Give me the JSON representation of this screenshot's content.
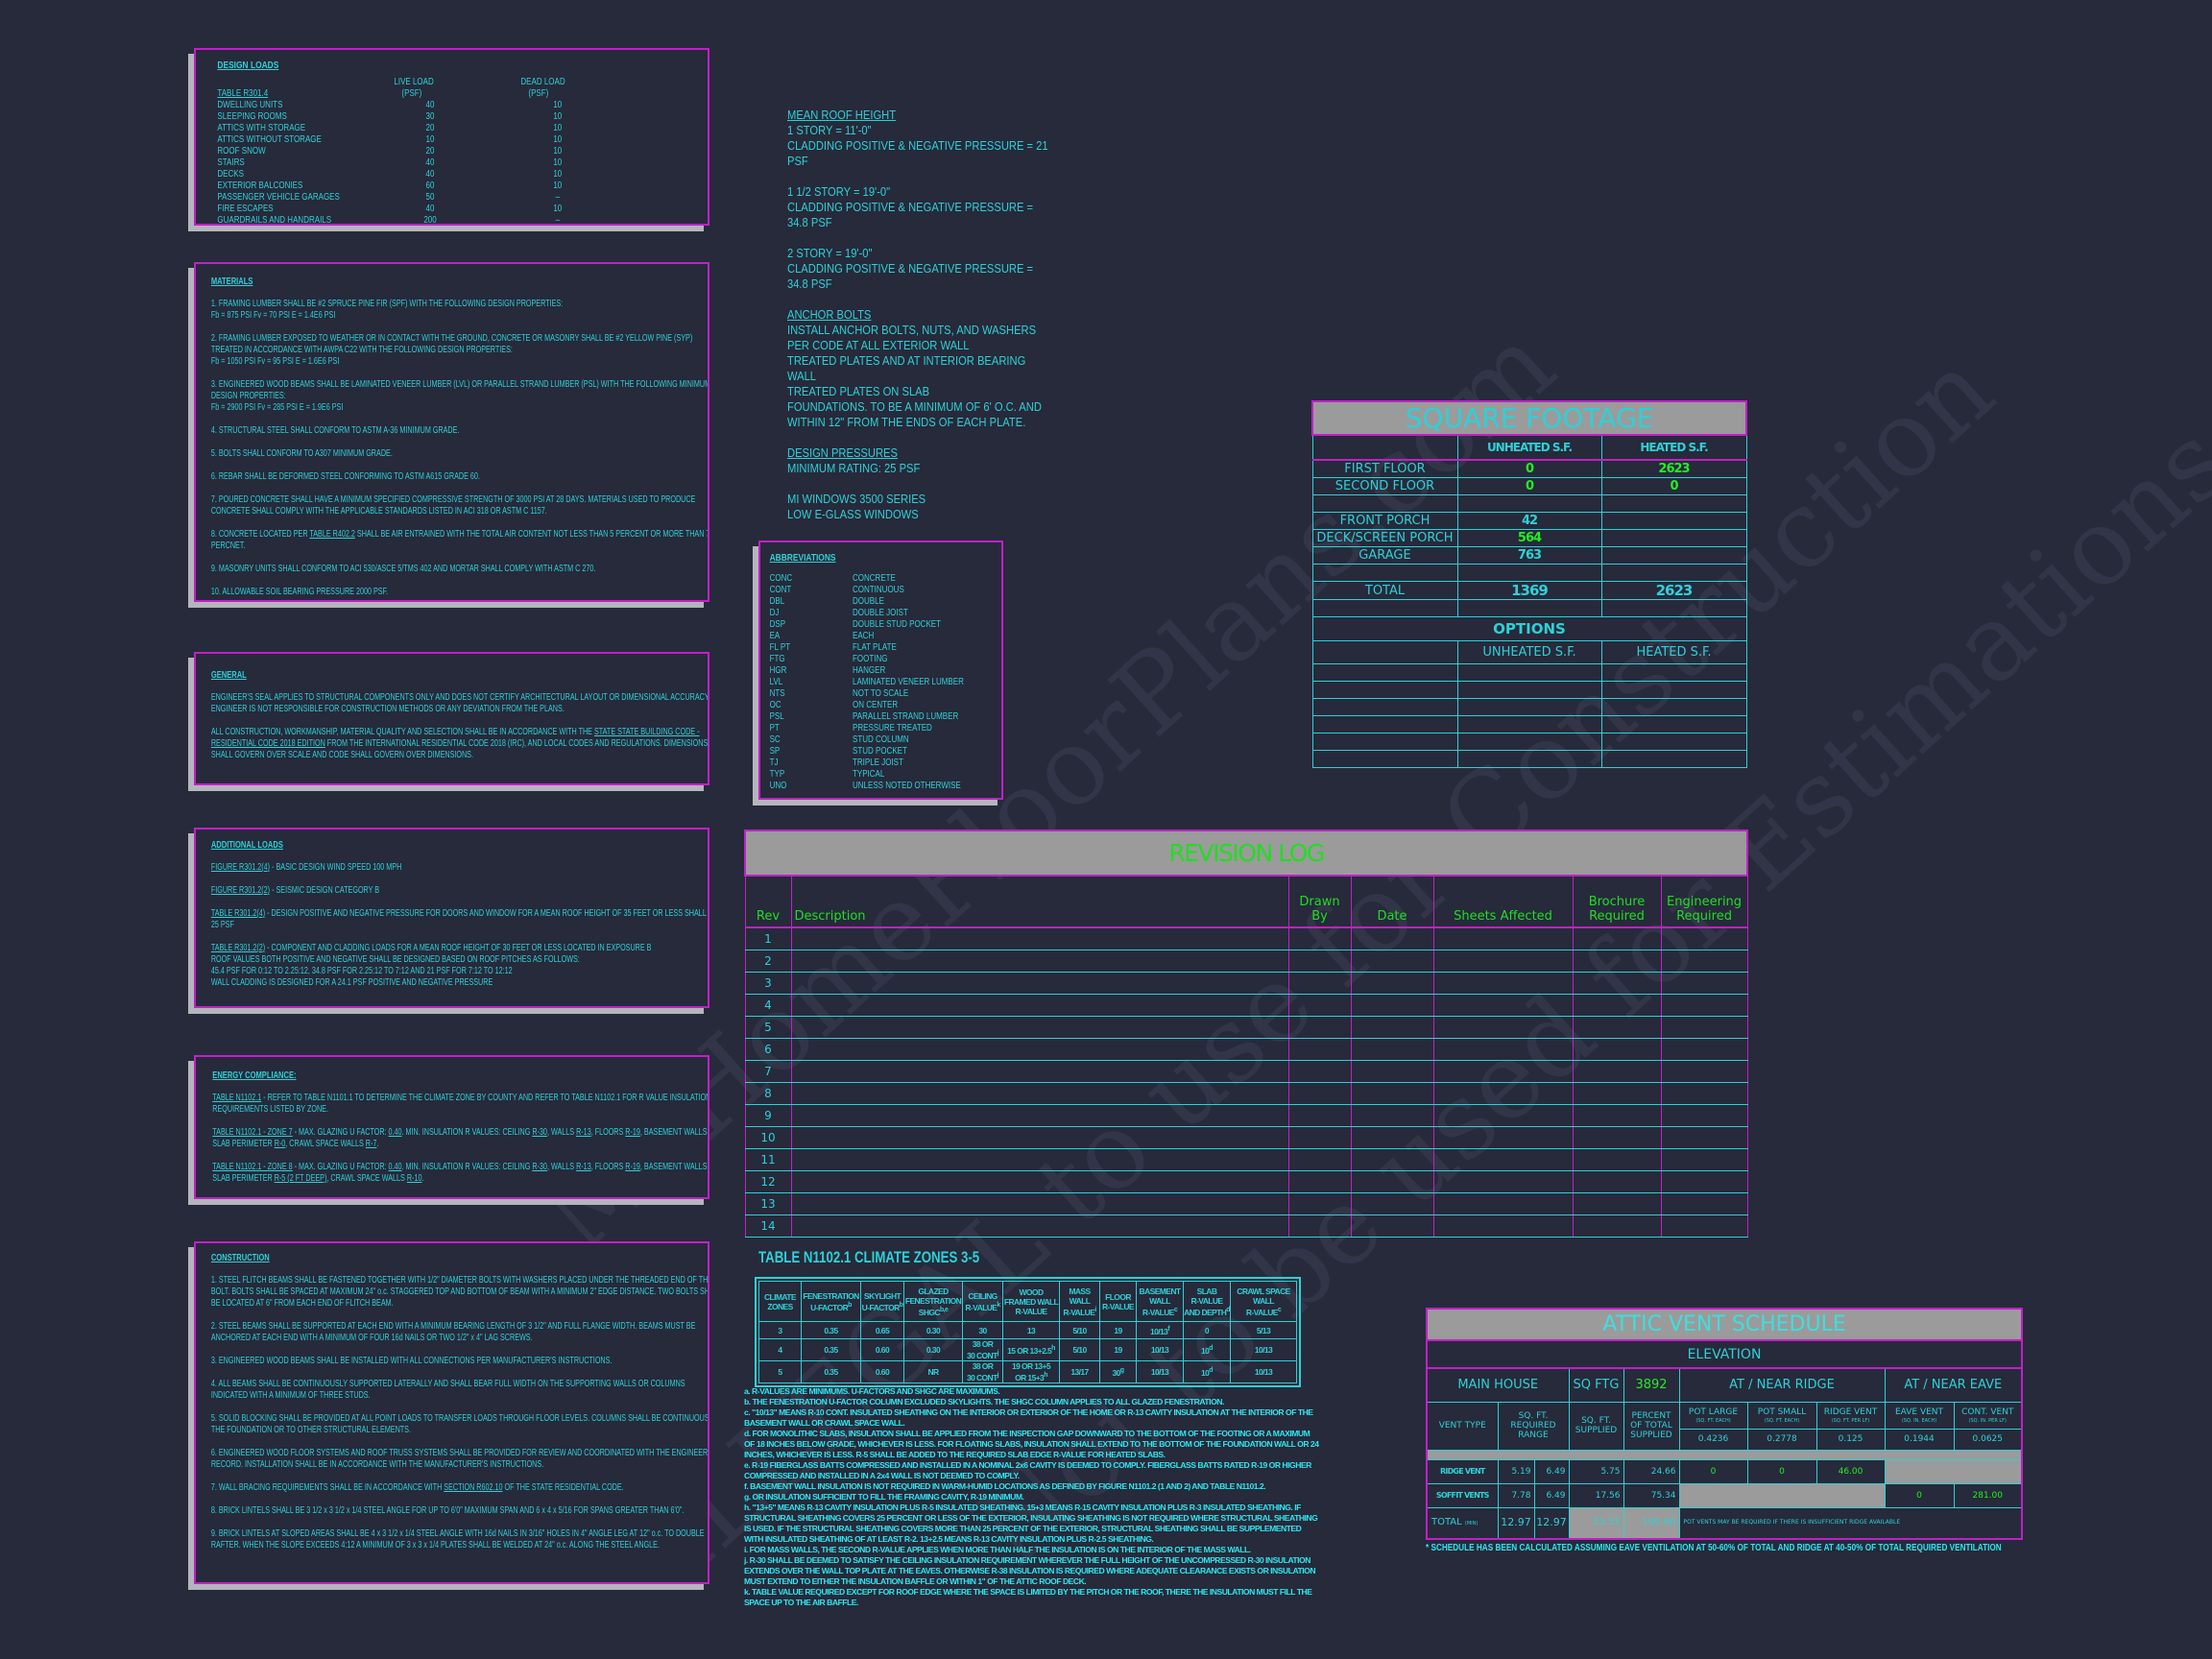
{
  "colors": {
    "background": "#262a3b",
    "text": "#2fd0d6",
    "border": "#c21fc8",
    "highlight": "#22ee22",
    "band": "#9b9b9b"
  },
  "watermark": [
    "© MyHomeFloorPlans.com",
    "ILLEGAL to use for Construction",
    "Not to be used for Estimations"
  ],
  "design_loads": {
    "title": "DESIGN LOADS",
    "table_ref": "TABLE R301.4",
    "live_header": "LIVE LOAD",
    "dead_header": "DEAD LOAD",
    "unit": "(PSF)",
    "rows": [
      [
        "DWELLING UNITS",
        "40",
        "10"
      ],
      [
        "SLEEPING ROOMS",
        "30",
        "10"
      ],
      [
        "ATTICS WITH STORAGE",
        "20",
        "10"
      ],
      [
        "ATTICS WITHOUT STORAGE",
        "10",
        "10"
      ],
      [
        "ROOF SNOW",
        "20",
        "10"
      ],
      [
        "STAIRS",
        "40",
        "10"
      ],
      [
        "DECKS",
        "40",
        "10"
      ],
      [
        "EXTERIOR BALCONIES",
        "60",
        "10"
      ],
      [
        "PASSENGER VEHICLE GARAGES",
        "50",
        "–"
      ],
      [
        "FIRE ESCAPES",
        "40",
        "10"
      ],
      [
        "GUARDRAILS AND HANDRAILS",
        "200",
        "–"
      ]
    ]
  },
  "materials": {
    "title": "MATERIALS",
    "items": [
      [
        "1. FRAMING LUMBER SHALL BE #2 SPRUCE PINE FIR (SPF) WITH THE FOLLOWING DESIGN PROPERTIES:\nFb = 875 PSI     Fv = 70 PSI     E = 1.4E6 PSI"
      ],
      [
        "2. FRAMING LUMBER EXPOSED TO WEATHER OR IN CONTACT WITH THE GROUND, CONCRETE OR MASONRY SHALL BE #2 YELLOW PINE (SYP) TREATED IN ACCORDANCE WITH AWPA C22 WITH THE FOLLOWING DESIGN PROPERTIES:\nFb = 1050 PSI    Fv = 95 PSI    E = 1.6E6 PSI"
      ],
      [
        "3. ENGINEERED WOOD BEAMS SHALL BE LAMINATED VENEER LUMBER (LVL) OR PARALLEL STRAND LUMBER (PSL) WITH THE FOLLOWING MINIMUM DESIGN PROPERTIES:\nFb = 2900 PSI    Fv = 285 PSI    E = 1.9E6 PSI"
      ],
      [
        "4. STRUCTURAL STEEL SHALL CONFORM TO ASTM A-36 MINIMUM GRADE."
      ],
      [
        "5. BOLTS SHALL CONFORM TO A307 MINIMUM GRADE."
      ],
      [
        "6. REBAR SHALL BE DEFORMED STEEL CONFORMING TO ASTM A615 GRADE 60."
      ],
      [
        "7. POURED CONCRETE SHALL HAVE A MINIMUM SPECIFIED COMPRESSIVE STRENGTH OF 3000 PSI AT 28 DAYS.  MATERIALS USED TO PRODUCE CONCRETE SHALL COMPLY WITH THE APPLICABLE STANDARDS LISTED IN ACI 318 OR ASTM C 1157."
      ],
      [
        "8. CONCRETE LOCATED PER ",
        {
          "u": "TABLE R402.2"
        },
        " SHALL BE AIR ENTRAINED WITH THE TOTAL AIR CONTENT NOT LESS THAN 5 PERCENT OR MORE THAN 7 PERCNET."
      ],
      [
        "9. MASONRY UNITS SHALL CONFORM TO ACI 530/ASCE 5/TMS 402 AND MORTAR SHALL COMPLY WITH ASTM C 270."
      ],
      [
        "10. ALLOWABLE SOIL BEARING PRESSURE 2000 PSF."
      ]
    ]
  },
  "general": {
    "title": "GENERAL",
    "items": [
      [
        "ENGINEER'S SEAL APPLIES TO STRUCTURAL COMPONENTS ONLY AND DOES NOT CERTIFY ARCHITECTURAL LAYOUT OR DIMENSIONAL ACCURACY.  ENGINEER IS NOT RESPONSIBLE FOR CONSTRUCTION METHODS OR ANY DEVIATION FROM THE PLANS."
      ],
      [
        "ALL CONSTRUCTION, WORKMANSHIP, MATERIAL QUALITY AND SELECTION SHALL BE IN ACCORDANCE WITH THE ",
        {
          "u": "STATE STATE BUILDING CODE - RESIDENTIAL CODE 2018 EDITION"
        },
        " FROM THE INTERNATIONAL RESIDENTIAL CODE 2018 (IRC), AND LOCAL CODES AND REGULATIONS.  DIMENSIONS SHALL GOVERN OVER SCALE AND CODE SHALL GOVERN OVER DIMENSIONS."
      ]
    ]
  },
  "additional_loads": {
    "title": "ADDITIONAL LOADS",
    "items": [
      [
        {
          "u": "FIGURE R301.2(4)"
        },
        " - BASIC DESIGN WIND SPEED 100 MPH"
      ],
      [
        {
          "u": "FIGURE R301.2(2)"
        },
        " - SEISMIC DESIGN CATEGORY B"
      ],
      [
        {
          "u": "TABLE R301.2(4)"
        },
        " - DESIGN POSITIVE AND NEGATIVE PRESSURE FOR DOORS AND WINDOW FOR A MEAN ROOF HEIGHT OF 35 FEET OR LESS SHALL BE 25 PSF"
      ],
      [
        {
          "u": "TABLE R301.2(2)"
        },
        " - COMPONENT AND CLADDING LOADS FOR A MEAN ROOF HEIGHT OF 30 FEET OR LESS LOCATED IN EXPOSURE B\nROOF VALUES BOTH POSITIVE AND NEGATIVE SHALL BE DESIGNED BASED ON ROOF PITCHES AS FOLLOWS:\n45.4 PSF FOR 0:12 TO 2.25:12, 34.8 PSF FOR 2.25:12 TO 7:12 AND 21 PSF FOR 7:12 TO 12:12\nWALL CLADDING IS DESIGNED FOR A 24.1 PSF POSITIVE AND NEGATIVE PRESSURE"
      ]
    ]
  },
  "energy": {
    "title": "ENERGY COMPLIANCE:",
    "items": [
      [
        {
          "u": "TABLE N1102.1"
        },
        " - REFER TO TABLE N1101.1 TO DETERMINE THE CLIMATE ZONE BY COUNTY  AND REFER TO TABLE N1102.1 FOR R VALUE INSULATION REQUIREMENTS LISTED BY ZONE."
      ],
      [
        {
          "u": "TABLE N1102.1 - ZONE 7"
        },
        " - MAX. GLAZING U FACTOR: ",
        {
          "u": "0.40"
        },
        ".  MIN. INSULATION R VALUES: CEILING ",
        {
          "u": "R-30"
        },
        ", WALLS ",
        {
          "u": "R-13"
        },
        ", FLOORS ",
        {
          "u": "R-19"
        },
        ", BASEMENT WALLS ",
        {
          "u": "R-7"
        },
        ", SLAB PERIMETER ",
        {
          "u": "R-0"
        },
        ", CRAWL SPACE WALLS ",
        {
          "u": "R-7"
        },
        "."
      ],
      [
        {
          "u": "TABLE N1102.1 - ZONE 8"
        },
        " - MAX. GLAZING U FACTOR: ",
        {
          "u": "0.40"
        },
        ".  MIN. INSULATION R VALUES: CEILING ",
        {
          "u": "R-30"
        },
        ", WALLS ",
        {
          "u": "R-13"
        },
        ", FLOORS ",
        {
          "u": "R-19"
        },
        ", BASEMENT WALLS ",
        {
          "u": "R-8"
        },
        ", SLAB PERIMETER ",
        {
          "u": "R-5 (2 FT DEEP)"
        },
        ", CRAWL SPACE WALLS ",
        {
          "u": "R-10"
        },
        "."
      ]
    ]
  },
  "construction": {
    "title": "CONSTRUCTION",
    "items": [
      [
        "1. STEEL FLITCH BEAMS SHALL BE FASTENED TOGETHER WITH 1/2\" DIAMETER BOLTS WITH WASHERS PLACED UNDER THE THREADED END OF THE BOLT.  BOLTS SHALL BE SPACED AT MAXIMUM 24\" o.c. STAGGERED TOP AND BOTTOM OF BEAM WITH A MINIMUM 2\" EDGE DISTANCE.  TWO BOLTS SHALL BE LOCATED AT 6\" FROM EACH END OF FLITCH BEAM."
      ],
      [
        "2. STEEL BEAMS SHALL BE SUPPORTED AT EACH END WITH A MINIMUM BEARING LENGTH OF 3 1/2\" AND FULL FLANGE WIDTH. BEAMS MUST BE ANCHORED AT EACH END WITH A MINIMUM OF FOUR 16d NAILS OR TWO 1/2\" x 4\" LAG SCREWS."
      ],
      [
        "3. ENGINEERED WOOD BEAMS SHALL BE INSTALLED WITH ALL CONNECTIONS PER MANUFACTURER'S INSTRUCTIONS."
      ],
      [
        "4. ALL BEAMS SHALL BE CONTINUOUSLY SUPPORTED LATERALLY AND SHALL BEAR FULL WIDTH ON THE SUPPORTING WALLS OR COLUMNS INDICATED WITH A MINIMUM OF THREE STUDS."
      ],
      [
        "5. SOLID BLOCKING SHALL BE PROVIDED AT ALL POINT LOADS TO TRANSFER LOADS THROUGH FLOOR LEVELS.  COLUMNS SHALL BE CONTINUOUS TO THE FOUNDATION OR TO OTHER STRUCTURAL ELEMENTS."
      ],
      [
        "6. ENGINEERED WOOD FLOOR SYSTEMS AND ROOF TRUSS SYSTEMS SHALL BE PROVIDED FOR REVIEW AND COORDINATED WITH THE ENGINEER OF RECORD.  INSTALLATION SHALL BE IN ACCORDANCE WITH THE MANUFACTURER'S INSTRUCTIONS."
      ],
      [
        "7. WALL BRACING REQUIREMENTS SHALL BE IN ACCORDANCE WITH ",
        {
          "u": "SECTION R602.10"
        },
        " OF THE STATE RESIDENTIAL CODE."
      ],
      [
        "8. BRICK LINTELS SHALL BE 3 1/2 x 3 1/2 x 1/4 STEEL ANGLE FOR UP TO 6'0\" MAXIMUM SPAN AND 6 x 4 x 5/16 FOR SPANS GREATER THAN 6'0\"."
      ],
      [
        "9. BRICK LINTELS AT SLOPED AREAS SHALL BE 4 x 3 1/2 x 1/4 STEEL ANGLE WITH 16d NAILS IN 3/16\" HOLES IN 4\" ANGLE LEG AT 12\" o.c. TO DOUBLE RAFTER.  WHEN THE SLOPE EXCEEDS 4:12 A MINIMUM OF 3 x 3 x 1/4 PLATES SHALL BE WELDED AT 24\" o.c. ALONG THE STEEL ANGLE."
      ]
    ]
  },
  "roof_notes": [
    {
      "heading": "MEAN ROOF HEIGHT",
      "text": "1 STORY = 11'-0\"\nCLADDING POSITIVE & NEGATIVE PRESSURE = 21\nPSF"
    },
    {
      "heading": "",
      "text": "1 1/2 STORY = 19'-0\"\nCLADDING POSITIVE & NEGATIVE PRESSURE =\n34.8 PSF"
    },
    {
      "heading": "",
      "text": "2 STORY = 19'-0\"\nCLADDING POSITIVE & NEGATIVE PRESSURE =\n34.8 PSF"
    },
    {
      "heading": "ANCHOR BOLTS",
      "text": "INSTALL ANCHOR BOLTS, NUTS, AND WASHERS\nPER CODE AT ALL EXTERIOR WALL\nTREATED PLATES AND AT INTERIOR BEARING\nWALL\nTREATED PLATES ON SLAB\nFOUNDATIONS. TO BE A MINIMUM OF 6' O.C. AND\nWITHIN 12\" FROM THE ENDS OF EACH PLATE."
    },
    {
      "heading": "DESIGN PRESSURES",
      "text": "MINIMUM RATING: 25 PSF"
    },
    {
      "heading": "",
      "text": "MI WINDOWS 3500 SERIES\nLOW E-GLASS WINDOWS"
    }
  ],
  "abbreviations": {
    "title": "ABBREVIATIONS",
    "rows": [
      [
        "CONC",
        "CONCRETE"
      ],
      [
        "CONT",
        "CONTINUOUS"
      ],
      [
        "DBL",
        "DOUBLE"
      ],
      [
        "DJ",
        "DOUBLE JOIST"
      ],
      [
        "DSP",
        "DOUBLE STUD POCKET"
      ],
      [
        "EA",
        "EACH"
      ],
      [
        "FL PT",
        "FLAT PLATE"
      ],
      [
        "FTG",
        "FOOTING"
      ],
      [
        "HGR",
        "HANGER"
      ],
      [
        "LVL",
        "LAMINATED VENEER LUMBER"
      ],
      [
        "NTS",
        "NOT TO SCALE"
      ],
      [
        "OC",
        "ON CENTER"
      ],
      [
        "PSL",
        "PARALLEL STRAND LUMBER"
      ],
      [
        "PT",
        "PRESSURE TREATED"
      ],
      [
        "SC",
        "STUD COLUMN"
      ],
      [
        "SP",
        "STUD POCKET"
      ],
      [
        "TJ",
        "TRIPLE JOIST"
      ],
      [
        "TYP",
        "TYPICAL"
      ],
      [
        "UNO",
        "UNLESS NOTED OTHERWISE"
      ]
    ]
  },
  "square_footage": {
    "title": "SQUARE FOOTAGE",
    "col_unheated": "UNHEATED S.F.",
    "col_heated": "HEATED S.F.",
    "rows": [
      {
        "label": "FIRST FLOOR",
        "unheated": "0",
        "heated": "2623"
      },
      {
        "label": "SECOND FLOOR",
        "unheated": "0",
        "heated": "0"
      },
      {
        "label": "",
        "unheated": "",
        "heated": ""
      },
      {
        "label": "FRONT PORCH",
        "unheated": "42",
        "heated": ""
      },
      {
        "label": "DECK/SCREEN PORCH",
        "unheated": "564",
        "heated": ""
      },
      {
        "label": "GARAGE",
        "unheated": "763",
        "heated": ""
      },
      {
        "label": "",
        "unheated": "",
        "heated": ""
      },
      {
        "label": "TOTAL",
        "unheated": "1369",
        "heated": "2623"
      },
      {
        "label": "",
        "unheated": "",
        "heated": ""
      }
    ],
    "options_title": "OPTIONS",
    "options_unheated": "UNHEATED S.F.",
    "options_heated": "HEATED S.F.",
    "options_rows": 6
  },
  "revision_log": {
    "title": "REVISION LOG",
    "headers": [
      "Rev",
      "Description",
      "Drawn\nBy",
      "Date",
      "Sheets Affected",
      "Brochure\nRequired",
      "Engineering\nRequired"
    ],
    "revs": [
      "1",
      "2",
      "3",
      "4",
      "5",
      "6",
      "7",
      "8",
      "9",
      "10",
      "11",
      "12",
      "13",
      "14"
    ]
  },
  "climate_table": {
    "title": "TABLE N1102.1 CLIMATE ZONES 3-5",
    "headers": [
      {
        "t": "CLIMATE\nZONES",
        "s": ""
      },
      {
        "t": "FENESTRATION\nU-FACTOR",
        "s": "b"
      },
      {
        "t": "SKYLIGHT\nU-FACTOR",
        "s": "b"
      },
      {
        "t": "GLAZED\nFENESTRATION\nSHGC",
        "s": "b,e"
      },
      {
        "t": "CEILING\nR-VALUE",
        "s": "k"
      },
      {
        "t": "WOOD\nFRAMED WALL\nR-VALUE",
        "s": ""
      },
      {
        "t": "MASS\nWALL\nR-VALUE",
        "s": "i"
      },
      {
        "t": "FLOOR\nR-VALUE",
        "s": ""
      },
      {
        "t": "BASEMENT\nWALL\nR-VALUE",
        "s": "c"
      },
      {
        "t": "SLAB\nR-VALUE\nAND DEPTH",
        "s": "d"
      },
      {
        "t": "CRAWL SPACE\nWALL\nR-VALUE",
        "s": "c"
      }
    ],
    "rows": [
      [
        {
          "t": "3"
        },
        {
          "t": "0.35"
        },
        {
          "t": "0.65"
        },
        {
          "t": "0.30"
        },
        {
          "t": "30"
        },
        {
          "t": "13"
        },
        {
          "t": "5/10"
        },
        {
          "t": "19"
        },
        {
          "t": "10/13",
          "s": "f"
        },
        {
          "t": "0"
        },
        {
          "t": "5/13"
        }
      ],
      [
        {
          "t": "4"
        },
        {
          "t": "0.35"
        },
        {
          "t": "0.60"
        },
        {
          "t": "0.30"
        },
        {
          "t": "38 OR\n30 CONT",
          "s": "j"
        },
        {
          "t": "15 OR 13+2.5",
          "s": "h"
        },
        {
          "t": "5/10"
        },
        {
          "t": "19"
        },
        {
          "t": "10/13"
        },
        {
          "t": "10",
          "s": "d"
        },
        {
          "t": "10/13"
        }
      ],
      [
        {
          "t": "5"
        },
        {
          "t": "0.35"
        },
        {
          "t": "0.60"
        },
        {
          "t": "NR"
        },
        {
          "t": "38 OR\n30 CONT",
          "s": "j"
        },
        {
          "t": "19 OR 13+5\nOR 15+3",
          "s": "h"
        },
        {
          "t": "13/17"
        },
        {
          "t": "30",
          "s": "g"
        },
        {
          "t": "10/13"
        },
        {
          "t": "10",
          "s": "d"
        },
        {
          "t": "10/13"
        }
      ]
    ],
    "notes": [
      "a. R-VALUES ARE MINIMUMS. U-FACTORS AND SHGC ARE MAXIMUMS.",
      "b. THE FENESTRATION U-FACTOR COLUMN EXCLUDED SKYLIGHTS. THE SHGC COLUMN APPLIES TO ALL GLAZED FENESTRATION.",
      "c. \"10/13\" MEANS R-10 CONT. INSULATED SHEATHING ON THE INTERIOR OR EXTERIOR OF THE HOME OR R-13 CAVITY INSULATION AT THE INTERIOR OF THE BASEMENT WALL OR CRAWL SPACE WALL.",
      "d. FOR MONOLITHIC SLABS, INSULATION SHALL BE APPLIED FROM THE INSPECTION GAP DOWNWARD TO THE BOTTOM OF THE FOOTING OR A MAXIMUM OF 18 INCHES BELOW GRADE, WHICHEVER IS LESS. FOR FLOATING SLABS, INSULATION SHALL EXTEND TO THE BOTTOM OF THE FOUNDATION WALL OR 24 INCHES, WHICHEVER IS LESS. R-5 SHALL BE ADDED TO THE REQUIRED SLAB EDGE R-VALUE FOR HEATED SLABS.",
      "e. R-19 FIBERGLASS BATTS COMPRESSED AND INSTALLED IN A NOMINAL 2x6 CAVITY IS DEEMED TO COMPLY. FIBERGLASS BATTS RATED R-19 OR HIGHER COMPRESSED AND INSTALLED IN A 2x4 WALL IS NOT DEEMED TO COMPLY.",
      "f. BASEMENT WALL INSULATION IS NOT REQUIRED IN WARM-HUMID LOCATIONS AS DEFINED BY FIGURE N1101.2 (1 AND 2) AND TABLE N1101.2.",
      "g. OR INSULATION SUFFICIENT TO FILL THE FRAMING CAVITY, R-19 MINIMUM.",
      "h. \"13+5\" MEANS R-13 CAVITY INSULATION PLUS R-5 INSULATED SHEATHING. 15+3 MEANS R-15 CAVITY INSULATION PLUS R-3 INSULATED SHEATHING. IF STRUCTURAL SHEATHING COVERS 25 PERCENT OR LESS OF THE EXTERIOR, INSULATING SHEATHING IS NOT REQUIRED WHERE STRUCTURAL SHEATHING IS USED. IF THE STRUCTURAL SHEATHING COVERS MORE THAN 25 PERCENT OF THE EXTERIOR, STRUCTURAL SHEATHING SHALL BE SUPPLEMENTED WITH INSULATED SHEATHING OF AT LEAST R-2. 13+2.5 MEANS R-13 CAVITY INSULATION PLUS R-2.5 SHEATHING.",
      "i. FOR MASS WALLS, THE SECOND R-VALUE APPLIES WHEN MORE THAN HALF THE INSULATION IS ON THE INTERIOR OF THE MASS WALL.",
      "j. R-30 SHALL BE DEEMED TO SATISFY THE CEILING INSULATION REQUIREMENT WHEREVER THE FULL HEIGHT OF THE UNCOMPRESSED R-30 INSULATION EXTENDS OVER THE WALL TOP PLATE AT THE EAVES. OTHERWISE R-38 INSULATION IS REQUIRED WHERE ADEQUATE CLEARANCE EXISTS OR INSULATION MUST EXTEND TO EITHER THE INSULATION BAFFLE OR WITHIN 1\" OF THE ATTIC ROOF DECK.",
      "k. TABLE VALUE REQUIRED EXCEPT FOR ROOF EDGE WHERE THE SPACE IS LIMITED BY THE PITCH OR THE ROOF, THERE THE INSULATION MUST FILL THE SPACE UP TO THE AIR BAFFLE."
    ]
  },
  "attic_vent": {
    "title": "ATTIC VENT SCHEDULE",
    "elevation": "ELEVATION",
    "main_house": "MAIN HOUSE",
    "sq_ftg_label": "SQ FTG",
    "sq_ftg": "3892",
    "ridge_group": "AT / NEAR RIDGE",
    "eave_group": "AT / NEAR EAVE",
    "vent_type": "VENT TYPE",
    "required_range": "SQ. FT.\nREQUIRED\nRANGE",
    "supplied": "SQ. FT.\nSUPPLIED",
    "percent": "PERCENT\nOF TOTAL\nSUPPLIED",
    "vent_cols": [
      {
        "name": "POT  LARGE",
        "unit": "(SQ. FT. EACH)",
        "value": "0.4236"
      },
      {
        "name": "POT  SMALL",
        "unit": "(SQ. FT. EACH)",
        "value": "0.2778"
      },
      {
        "name": "RIDGE VENT",
        "unit": "(SQ. FT. PER LF)",
        "value": "0.125"
      },
      {
        "name": "EAVE VENT",
        "unit": "(SQ. IN. EACH)",
        "value": "0.1944"
      },
      {
        "name": "CONT. VENT",
        "unit": "(SQ. IN. PER LF)",
        "value": "0.0625"
      }
    ],
    "ridge": {
      "label": "RIDGE VENT",
      "min": "5.19",
      "max": "6.49",
      "supplied": "5.75",
      "percent": "24.66",
      "pot_large": "0",
      "pot_small": "0",
      "ridge_vent": "46.00"
    },
    "soffit": {
      "label": "SOFFIT VENTS",
      "min": "7.78",
      "max": "6.49",
      "supplied": "17.56",
      "percent": "75.34",
      "eave_vent": "0",
      "cont_vent": "281.00"
    },
    "total": {
      "label": "TOTAL",
      "label_sub": "(MIN)",
      "min": "12.97",
      "max": "12.97",
      "supplied": "23.31",
      "percent": "100.00",
      "note": "POT VENTS MAY BE REQUIRED IF THERE IS INSUFFICIENT RIDGE AVAILABLE"
    },
    "footnote": "* SCHEDULE HAS BEEN CALCULATED ASSUMING EAVE VENTILATION AT 50-60% OF TOTAL AND RIDGE AT 40-50% OF TOTAL REQUIRED VENTILATION"
  }
}
